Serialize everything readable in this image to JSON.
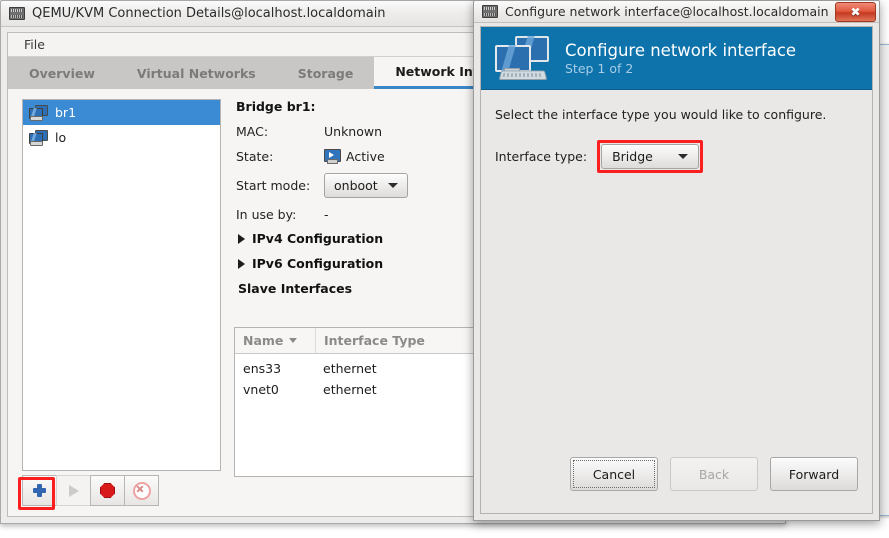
{
  "colors": {
    "accent_blue": "#3a87c8",
    "header_blue": "#0e72ab",
    "selection_blue": "#3b8bd4",
    "highlight_red": "#fb1f1f",
    "close_red": "#c63a21"
  },
  "main_window": {
    "title": "QEMU/KVM Connection Details@localhost.localdomain",
    "menubar": {
      "items": [
        "File"
      ]
    },
    "tabs": [
      {
        "label": "Overview",
        "active": false
      },
      {
        "label": "Virtual Networks",
        "active": false
      },
      {
        "label": "Storage",
        "active": false
      },
      {
        "label": "Network Interfaces",
        "active": true
      }
    ],
    "interface_list": [
      {
        "name": "br1",
        "selected": true
      },
      {
        "name": "lo",
        "selected": false
      }
    ],
    "details": {
      "heading": "Bridge br1:",
      "mac_label": "MAC:",
      "mac_value": "Unknown",
      "state_label": "State:",
      "state_value": "Active",
      "start_mode_label": "Start mode:",
      "start_mode_value": "onboot",
      "in_use_by_label": "In use by:",
      "in_use_by_value": "-",
      "ipv4_expander": "IPv4 Configuration",
      "ipv6_expander": "IPv6 Configuration"
    },
    "slave_interfaces": {
      "title": "Slave Interfaces",
      "columns": [
        "Name",
        "Interface Type"
      ],
      "rows": [
        {
          "name": "ens33",
          "type": "ethernet"
        },
        {
          "name": "vnet0",
          "type": "ethernet"
        }
      ]
    },
    "toolbar": [
      {
        "name": "add",
        "icon": "plus-icon",
        "enabled": true,
        "highlighted": true
      },
      {
        "name": "start",
        "icon": "play-icon",
        "enabled": false,
        "highlighted": false
      },
      {
        "name": "stop",
        "icon": "stop-icon",
        "enabled": true,
        "highlighted": false
      },
      {
        "name": "delete",
        "icon": "delete-icon",
        "enabled": false,
        "highlighted": false
      }
    ]
  },
  "dialog": {
    "title": "Configure network interface@localhost.localdomain",
    "close_label": "✖",
    "header": {
      "title": "Configure network interface",
      "step": "Step 1 of 2",
      "icon": "two-monitors-icon"
    },
    "prompt": "Select the interface type you would like to configure.",
    "interface_type_label": "Interface type:",
    "interface_type_value": "Bridge",
    "buttons": [
      {
        "label": "Cancel",
        "state": "focused"
      },
      {
        "label": "Back",
        "state": "disabled"
      },
      {
        "label": "Forward",
        "state": "normal"
      }
    ]
  }
}
